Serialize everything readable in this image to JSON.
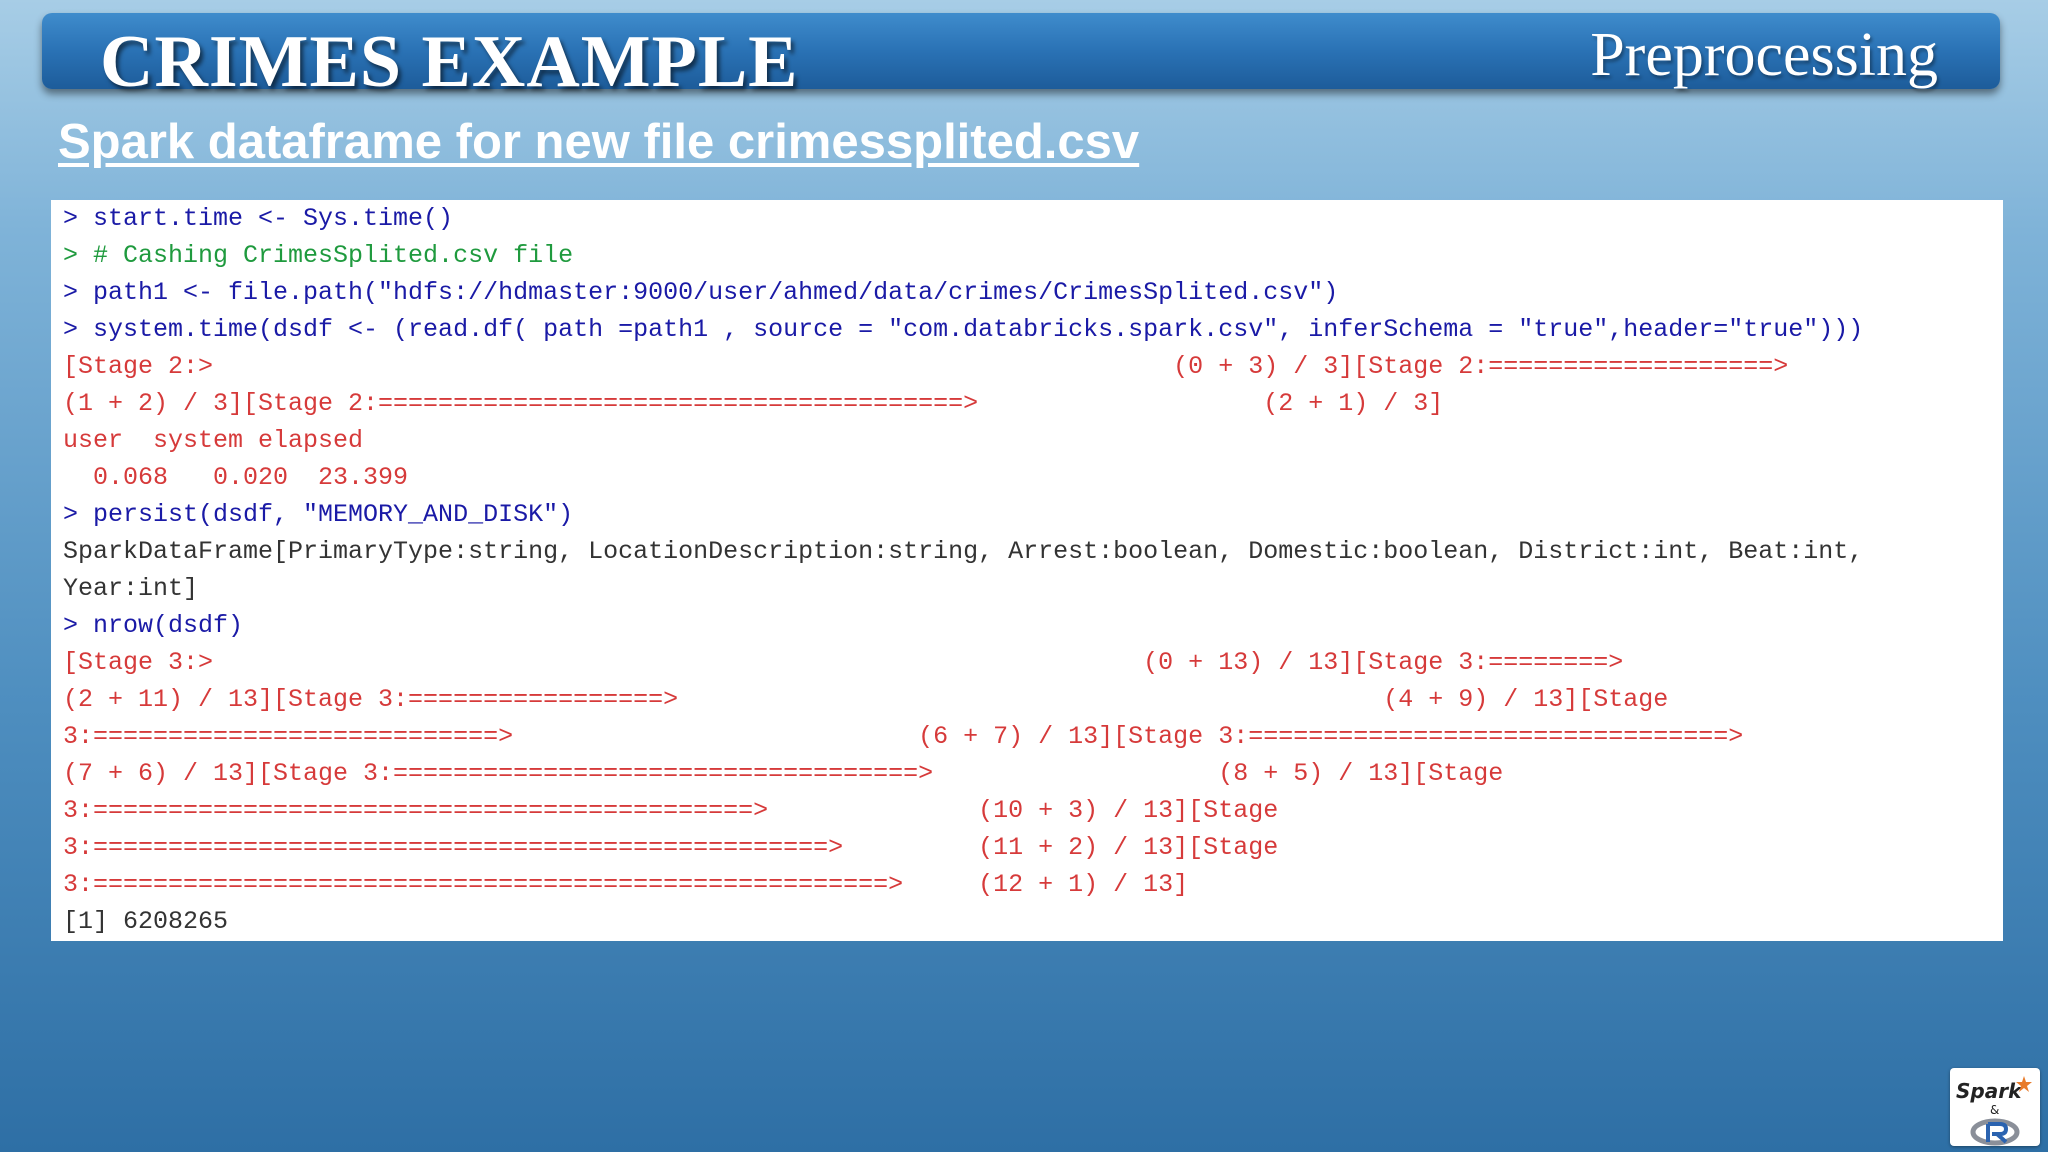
{
  "header": {
    "title": "CRIMES EXAMPLE",
    "section": "Preprocessing"
  },
  "subtitle": "Spark dataframe for new file crimessplited.csv",
  "console": {
    "lines": [
      {
        "type": "cmd",
        "text": "> start.time <- Sys.time()"
      },
      {
        "type": "cmt",
        "text": "> # Cashing CrimesSplited.csv file"
      },
      {
        "type": "cmd",
        "text": "> path1 <- file.path(\"hdfs://hdmaster:9000/user/ahmed/data/crimes/CrimesSplited.csv\")"
      },
      {
        "type": "cmd",
        "text": "> system.time(dsdf <- (read.df( path =path1 , source = \"com.databricks.spark.csv\", inferSchema = \"true\",header=\"true\")))"
      },
      {
        "type": "err",
        "text": "[Stage 2:>                                                                (0 + 3) / 3][Stage 2:===================>"
      },
      {
        "type": "err",
        "text": "(1 + 2) / 3][Stage 2:=======================================>                   (2 + 1) / 3]"
      },
      {
        "type": "err",
        "text": "user  system elapsed"
      },
      {
        "type": "err",
        "text": "  0.068   0.020  23.399"
      },
      {
        "type": "cmd",
        "text": "> persist(dsdf, \"MEMORY_AND_DISK\")"
      },
      {
        "type": "out",
        "text": "SparkDataFrame[PrimaryType:string, LocationDescription:string, Arrest:boolean, Domestic:boolean, District:int, Beat:int,"
      },
      {
        "type": "out",
        "text": "Year:int]"
      },
      {
        "type": "cmd",
        "text": "> nrow(dsdf)"
      },
      {
        "type": "err",
        "text": "[Stage 3:>                                                              (0 + 13) / 13][Stage 3:========>"
      },
      {
        "type": "err",
        "text": "(2 + 11) / 13][Stage 3:=================>                                               (4 + 9) / 13][Stage"
      },
      {
        "type": "err",
        "text": "3:===========================>                           (6 + 7) / 13][Stage 3:================================>"
      },
      {
        "type": "err",
        "text": "(7 + 6) / 13][Stage 3:===================================>                   (8 + 5) / 13][Stage"
      },
      {
        "type": "err",
        "text": "3:============================================>              (10 + 3) / 13][Stage"
      },
      {
        "type": "err",
        "text": "3:=================================================>         (11 + 2) / 13][Stage"
      },
      {
        "type": "err",
        "text": "3:=====================================================>     (12 + 1) / 13]"
      },
      {
        "type": "out",
        "text": "[1] 6208265"
      }
    ]
  },
  "logo": {
    "line1": "Spark",
    "line2": "&"
  }
}
